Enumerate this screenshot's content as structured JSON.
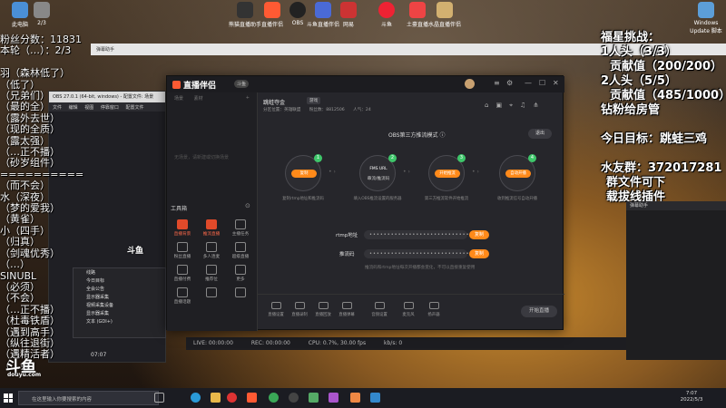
{
  "desktop": {
    "icons": [
      {
        "label": "此电脑"
      },
      {
        "label": "2/3"
      },
      {
        "label": "熊猫直播助手"
      },
      {
        "label": "直播伴侣"
      },
      {
        "label": "OBS"
      },
      {
        "label": "斗鱼直播伴侣"
      },
      {
        "label": "网易"
      },
      {
        "label": "斗鱼"
      },
      {
        "label": "土豪直播"
      },
      {
        "label": "水晶直播伴侣"
      }
    ],
    "recycle_label": "Windows Update 脚本"
  },
  "overlay_left": {
    "lines": [
      "粉丝分数：11831",
      "本轮（…）：2/3",
      "",
      "羽（森林低了）",
      "（低了）",
      "（兄弟们）",
      "（最的全）",
      "（露外去世）",
      "（现的全质）",
      "（露太强）",
      "（…正不播）",
      "（砂岁组件）",
      "==========",
      "（而不会）",
      "水（深夜）",
      "（梦的爱我）",
      "（黄雀）",
      "小（四手）",
      "（归真）",
      "（剑魂优秀）",
      "（…）",
      "SINUBL",
      "（必须）",
      "（不会）",
      "（…正不播）",
      "（杜毒铁盾）",
      "（遇到高手）",
      "（纵往退街）",
      "（遇精活者）",
      "（…会）"
    ]
  },
  "overlay_right": {
    "title": "福星挑战：",
    "line1": "1人头（3/3）",
    "line2": "贡献值（200/200）",
    "line3": "2人头（5/5）",
    "line4": "贡献值（485/1000）",
    "line5": "钻粉给房管",
    "line6": "今日目标：跳蛙三鸡",
    "line7": "水友群：372017281",
    "line8": "群文件可下",
    "line9": "载拔线插件"
  },
  "obs": {
    "title": "OBS 27.0.1 (64-bit, windows) - 配置文件: 场景",
    "menu": [
      "文件",
      "编辑",
      "视图",
      "停靠窗口",
      "配置文件"
    ],
    "dock_items": [
      "线路",
      "今日目标",
      "全会公告",
      "显示器采集",
      "视频采集设备",
      "显示器采集",
      "文本 (GDI+)"
    ],
    "status": [
      "LIVE: 00:00:00",
      "REC: 00:00:00",
      "CPU: 0.7%, 30.00 fps",
      "kb/s: 0"
    ],
    "time": "07:07"
  },
  "white_strip": {
    "text": "弹幕助手"
  },
  "app": {
    "logo": "直播伴侣",
    "version": "斗鱼",
    "left_tabs": [
      "场景",
      "素材",
      "+"
    ],
    "empty_hint": "无场景，请新建或切换场景",
    "tools_heading": "工具箱",
    "tools": [
      {
        "label": "直播背景",
        "active": true
      },
      {
        "label": "推流直播",
        "active": true
      },
      {
        "label": "主播任务",
        "active": false
      },
      {
        "label": "粉丝直播",
        "active": false
      },
      {
        "label": "多人连麦",
        "active": false
      },
      {
        "label": "超级直播",
        "active": false
      },
      {
        "label": "直播付费",
        "active": false
      },
      {
        "label": "推荐位",
        "active": false
      },
      {
        "label": "更多",
        "active": false
      },
      {
        "label": "直播话题",
        "active": false
      },
      {
        "label": "",
        "active": false
      },
      {
        "label": "",
        "active": false
      }
    ],
    "room_title": "跳蛙夺金",
    "room_tag": "游戏",
    "room_sub": [
      "分区位置：英雄联盟",
      "粉丝数：8812506",
      "人气：24"
    ],
    "mode_title": "OBS第三方推流模式",
    "exit_label": "退出",
    "steps": [
      {
        "num": "1",
        "pill": "复制",
        "desc": "复制rtmp地址和推流码"
      },
      {
        "num": "2",
        "pill": "FMS URL",
        "desc": "填入OBS推流设置的服务器"
      },
      {
        "num": "3",
        "pill": "开始推流",
        "desc": "第三方推流软件开始推流"
      },
      {
        "num": "4",
        "pill": "自动开播",
        "desc": "收到推流信号自动开播"
      }
    ],
    "step2_sub": "串流/推流码",
    "fields": [
      {
        "label": "rtmp地址",
        "value": "••••••••••••••••••••••••••••••••",
        "copy": "复制"
      },
      {
        "label": "推流码",
        "value": "••••••••••••••••••••••••••••••••",
        "copy": "复制"
      }
    ],
    "hint": "推流码和rtmp地址每次开播都会变化，不可以直接重复使用",
    "bottom": [
      {
        "label": "直播设置"
      },
      {
        "label": "直播录制"
      },
      {
        "label": "直播回放"
      },
      {
        "label": "直播弹幕"
      },
      {
        "label": "音频设置"
      },
      {
        "label": "麦克风"
      },
      {
        "label": "扬声器"
      }
    ],
    "start_label": "开始直播"
  },
  "small_window": {
    "title": "弹幕助手"
  },
  "watermarks": {
    "left": "斗鱼",
    "left_small": "douyu.com",
    "bottom": "斗鱼"
  },
  "taskbar": {
    "search_placeholder": "在这里输入你要搜索的内容",
    "time": "7:07",
    "date": "2022/5/3"
  }
}
